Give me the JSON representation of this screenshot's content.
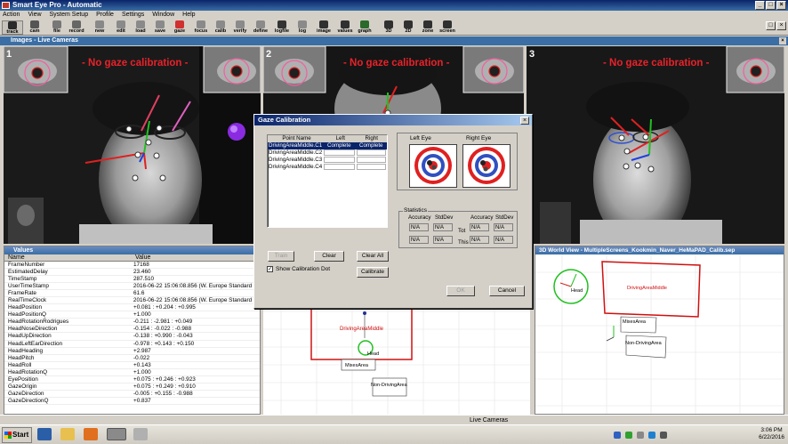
{
  "app": {
    "title": "Smart Eye Pro - Automatic"
  },
  "menu": [
    "Action",
    "View",
    "System Setup",
    "Profile",
    "Settings",
    "Window",
    "Help"
  ],
  "toolbar": [
    {
      "label": "track",
      "icon": "track-icon",
      "color": "#2a2a2a",
      "active": true
    },
    {
      "label": "cam",
      "icon": "camera-icon",
      "color": "#555555"
    },
    {
      "label": "file",
      "icon": "file-icon",
      "color": "#777777"
    },
    {
      "label": "record",
      "icon": "record-icon",
      "color": "#666666"
    },
    {
      "label": "new",
      "icon": "new-icon",
      "color": "#888888"
    },
    {
      "label": "edit",
      "icon": "edit-icon",
      "color": "#8a8a8a"
    },
    {
      "label": "load",
      "icon": "load-icon",
      "color": "#8a8a8a"
    },
    {
      "label": "save",
      "icon": "save-icon",
      "color": "#8a8a8a"
    },
    {
      "label": "gaze",
      "icon": "gaze-icon",
      "color": "#d03030"
    },
    {
      "label": "focus",
      "icon": "focus-icon",
      "color": "#8a8a8a"
    },
    {
      "label": "calib",
      "icon": "calibration-icon",
      "color": "#8a8a8a"
    },
    {
      "label": "verify",
      "icon": "verify-icon",
      "color": "#8a8a8a"
    },
    {
      "label": "define",
      "icon": "define-icon",
      "color": "#8a8a8a"
    },
    {
      "label": "logfile",
      "icon": "logfile-icon",
      "color": "#333333"
    },
    {
      "label": "log",
      "icon": "log-icon",
      "color": "#8a8a8a"
    },
    {
      "label": "image",
      "icon": "image-icon",
      "color": "#303030"
    },
    {
      "label": "values",
      "icon": "values-icon",
      "color": "#303030"
    },
    {
      "label": "graph",
      "icon": "graph-icon",
      "color": "#2a6a2a"
    },
    {
      "label": "3D",
      "icon": "3d-icon",
      "color": "#303030"
    },
    {
      "label": "2D",
      "icon": "2d-icon",
      "color": "#303030"
    },
    {
      "label": "zone",
      "icon": "zone-icon",
      "color": "#303030"
    },
    {
      "label": "screen",
      "icon": "screen-icon",
      "color": "#303030"
    }
  ],
  "images_panel": {
    "title": "Images - Live Cameras"
  },
  "cameras": [
    {
      "number": "1",
      "message": "- No gaze calibration -"
    },
    {
      "number": "2",
      "message": "- No gaze calibration -"
    },
    {
      "number": "3",
      "message": "- No gaze calibration -"
    }
  ],
  "values_panel": {
    "title": "Values",
    "col_name": "Name",
    "col_value": "Value",
    "rows": [
      {
        "name": "FrameNumber",
        "value": "17168"
      },
      {
        "name": "EstimatedDelay",
        "value": "23.460"
      },
      {
        "name": "TimeStamp",
        "value": "287.510"
      },
      {
        "name": "UserTimeStamp",
        "value": "2016-06-22 15:06:08.856 (W. Europe Standard Tir"
      },
      {
        "name": "FrameRate",
        "value": "61.6"
      },
      {
        "name": "RealTimeClock",
        "value": "2016-06-22 15:06:08.856 (W. Europe Standard Tir"
      },
      {
        "name": "HeadPosition",
        "value": "+0.081 : +0.204 : +0.995"
      },
      {
        "name": "HeadPositionQ",
        "value": "+1.000"
      },
      {
        "name": "HeadRotationRodrigues",
        "value": "-0.211 : -2.981 : +0.049"
      },
      {
        "name": "HeadNoseDirection",
        "value": "-0.154 : -0.022 : -0.988"
      },
      {
        "name": "HeadUpDirection",
        "value": "-0.138 : +0.990 : -0.043"
      },
      {
        "name": "HeadLeftEarDirection",
        "value": "-0.978 : +0.143 : +0.150"
      },
      {
        "name": "HeadHeading",
        "value": "+2.987"
      },
      {
        "name": "HeadPitch",
        "value": "-0.022"
      },
      {
        "name": "HeadRoll",
        "value": "+0.143"
      },
      {
        "name": "HeadRotationQ",
        "value": "+1.000"
      },
      {
        "name": "EyePosition",
        "value": "+0.075 : +0.246 : +0.923"
      },
      {
        "name": "GazeOrigin",
        "value": "+0.075 : +0.249 : +0.910"
      },
      {
        "name": "GazeDirection",
        "value": "-0.005 : +0.155 : -0.988"
      },
      {
        "name": "GazeDirectionQ",
        "value": "+0.837"
      }
    ]
  },
  "world_view": {
    "title": "3D World View - MultipleScreens_Kookmin_Naver_HeMaPAD_Calib.sep",
    "labels": {
      "driving": "DrivingAreaMiddle",
      "mixes": "MixesArea",
      "non_driving": "Non-DrivingArea",
      "head": "Head"
    }
  },
  "dialog": {
    "title": "Gaze Calibration",
    "table": {
      "headers": [
        "Point Name",
        "Left",
        "Right"
      ],
      "rows": [
        {
          "name": "DrivingAreaMiddle.C1",
          "left": "Complete",
          "right": "Complete",
          "selected": true
        },
        {
          "name": "DrivingAreaMiddle.C2",
          "left": "",
          "right": ""
        },
        {
          "name": "DrivingAreaMiddle.C3",
          "left": "",
          "right": ""
        },
        {
          "name": "DrivingAreaMiddle.C4",
          "left": "",
          "right": ""
        }
      ]
    },
    "left_eye": "Left Eye",
    "right_eye": "Right Eye",
    "stats": {
      "group": "Statistics",
      "accuracy": "Accuracy",
      "stddev": "StdDev",
      "tot": "Tot",
      "this": "This",
      "na": "N/A"
    },
    "buttons": {
      "train": "Train",
      "clear": "Clear",
      "clear_all": "Clear All",
      "calibrate": "Calibrate",
      "ok": "OK",
      "cancel": "Cancel"
    },
    "checkbox": {
      "label": "Show Calibration Dot",
      "checked": true
    }
  },
  "statusbar": {
    "text": "Live Cameras"
  },
  "taskbar": {
    "start": "Start",
    "time": "3:06 PM",
    "date": "6/22/2016"
  }
}
